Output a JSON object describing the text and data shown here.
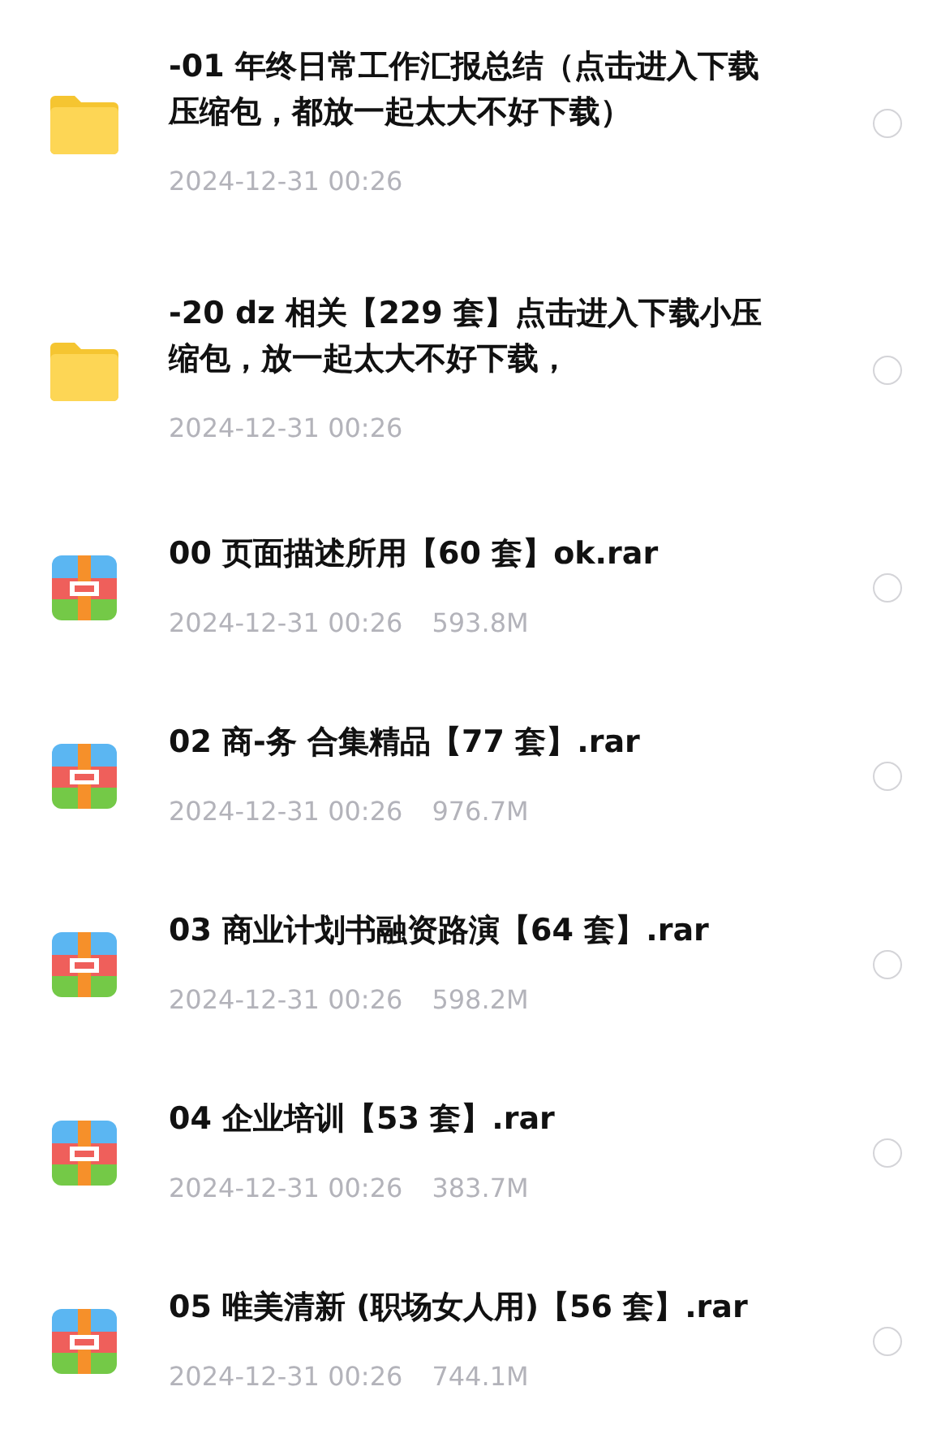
{
  "files": [
    {
      "kind": "folder",
      "name": "-01 年终日常工作汇报总结（点击进入下载压缩包，都放一起太大不好下载）",
      "date": "2024-12-31 00:26",
      "selected": false
    },
    {
      "kind": "folder",
      "name": "-20 dz 相关【229 套】点击进入下载小压缩包，放一起太大不好下载，",
      "date": "2024-12-31 00:26",
      "selected": false
    },
    {
      "kind": "archive",
      "name": "00 页面描述所用【60 套】ok.rar",
      "date": "2024-12-31 00:26",
      "size": "593.8M",
      "selected": false
    },
    {
      "kind": "archive",
      "name": "02 商-务 合集精品【77 套】.rar",
      "date": "2024-12-31 00:26",
      "size": "976.7M",
      "selected": false
    },
    {
      "kind": "archive",
      "name": "03 商业计划书融资路演【64 套】.rar",
      "date": "2024-12-31 00:26",
      "size": "598.2M",
      "selected": false
    },
    {
      "kind": "archive",
      "name": "04 企业培训【53 套】.rar",
      "date": "2024-12-31 00:26",
      "size": "383.7M",
      "selected": false
    },
    {
      "kind": "archive",
      "name": "05 唯美清新 (职场女人用)【56 套】.rar",
      "date": "2024-12-31 00:26",
      "size": "744.1M",
      "selected": false
    }
  ]
}
